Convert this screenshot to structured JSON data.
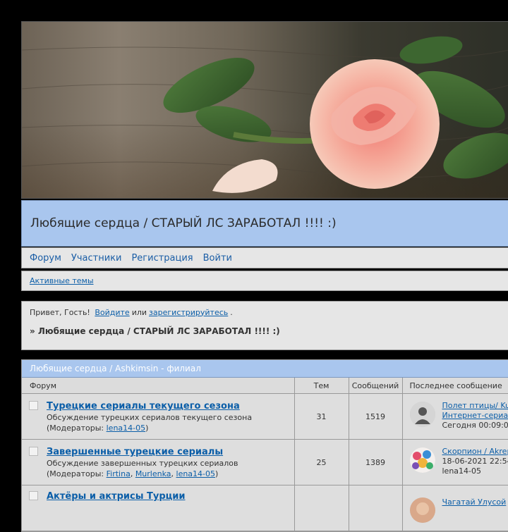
{
  "header": {
    "forum_title": "Любящие сердца / СТАРЫЙ ЛС ЗАРАБОТАЛ !!!! :)"
  },
  "nav": {
    "items": [
      "Форум",
      "Участники",
      "Регистрация",
      "Войти"
    ]
  },
  "subnav": {
    "active_topics": "Активные темы"
  },
  "welcome": {
    "greeting": "Привет, Гость!",
    "login_link": "Войдите",
    "or": "или",
    "register_link": "зарегистрируйтесь",
    "period": "."
  },
  "breadcrumb": "» Любящие сердца / СТАРЫЙ ЛС ЗАРАБОТАЛ !!!! :)",
  "category": {
    "title": "Любящие сердца / Ashkimsin - филиал",
    "columns": [
      "Форум",
      "Тем",
      "Сообщений",
      "Последнее сообщение"
    ],
    "mods_prefix": "(Модераторы: ",
    "mods_suffix": ")",
    "forums": [
      {
        "title": "Турецкие сериалы текущего сезона",
        "desc": "Обсуждение турецких сериалов текущего сезона",
        "mods": [
          "lena14-05"
        ],
        "topics": "31",
        "posts": "1519",
        "last_post": {
          "line1": "Полет птицы/ Ku",
          "line2": "Интернет-сериа",
          "line3": "Сегодня 00:09:0"
        },
        "avatar": "user-silhouette-icon"
      },
      {
        "title": "Завершенные турецкие сериалы",
        "desc": "Обсуждение завершенных турецких сериалов",
        "mods": [
          "Firtina",
          "Murlenka",
          "lena14-05"
        ],
        "topics": "25",
        "posts": "1389",
        "last_post": {
          "line1": "Скорпион / Akrep",
          "line2": "18-06-2021 22:54",
          "line3": "lena14-05"
        },
        "avatar": "colorful-group-avatar"
      },
      {
        "title": "Актёры и актрисы Турции",
        "desc": "",
        "mods": [],
        "topics": "",
        "posts": "",
        "last_post": {
          "line1": "Чагатай Улусой",
          "line2": "",
          "line3": ""
        },
        "avatar": "photo-avatar"
      }
    ]
  },
  "colors": {
    "title_bar": "#a9c6ee",
    "link": "#0b5ea8",
    "panel": "#e6e6e6",
    "background": "#000000"
  }
}
